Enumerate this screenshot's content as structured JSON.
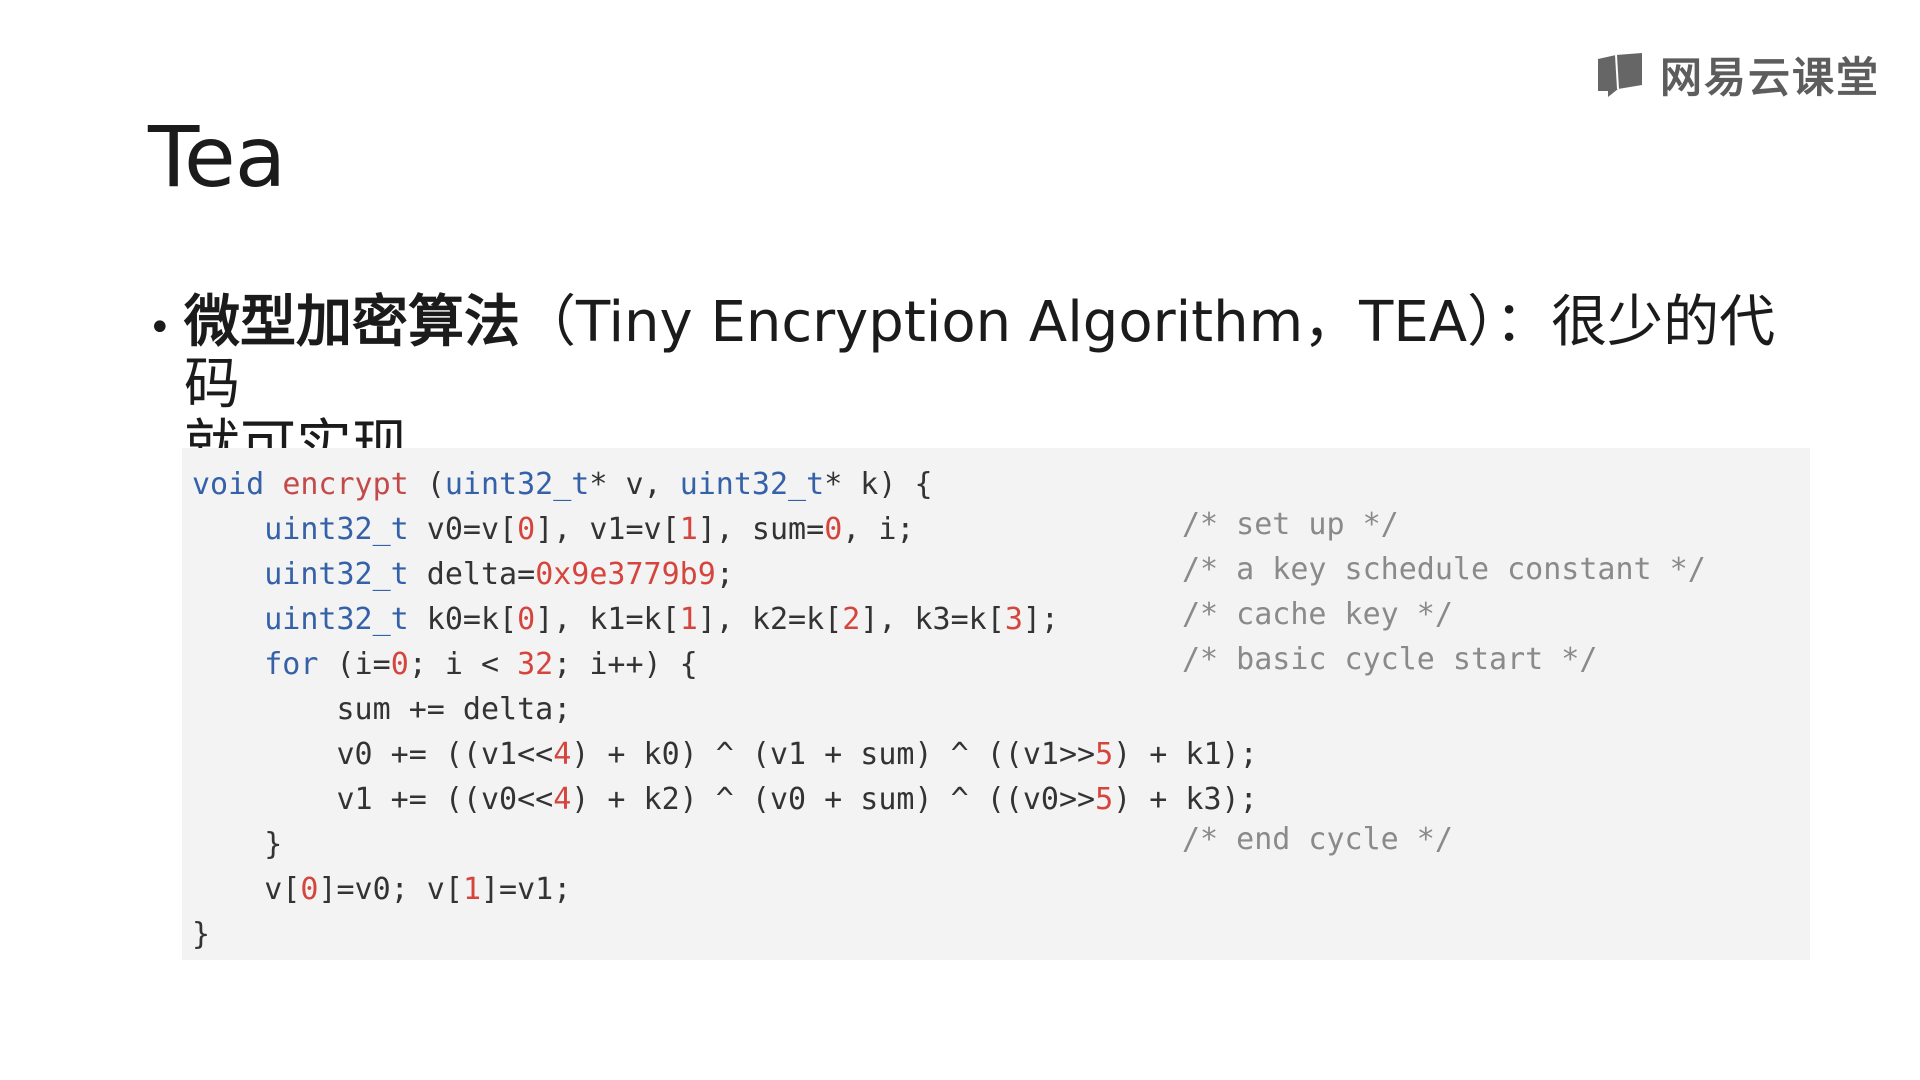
{
  "logo": {
    "text": "网易云课堂",
    "icon": "book-icon"
  },
  "slide": {
    "title": "Tea",
    "bullet": {
      "bold": "微型加密算法",
      "rest": "（Tiny Encryption Algorithm，TEA）：很少的代码",
      "cont": "就可实现"
    }
  },
  "code": {
    "line1": {
      "kw1": "void",
      "sp1": " ",
      "fn": "encrypt",
      "p1": " (",
      "kw2": "uint32_t",
      "p2": "* v, ",
      "kw3": "uint32_t",
      "p3": "* k) {"
    },
    "line2": {
      "indent": "    ",
      "kw": "uint32_t",
      "a": " v0=v[",
      "n1": "0",
      "b": "], v1=v[",
      "n2": "1",
      "c": "], sum=",
      "n3": "0",
      "d": ", i;",
      "comment": "/* set up */"
    },
    "line3": {
      "indent": "    ",
      "kw": "uint32_t",
      "a": " delta=",
      "n1": "0x9e3779b9",
      "b": ";",
      "comment": "/* a key schedule constant */"
    },
    "line4": {
      "indent": "    ",
      "kw": "uint32_t",
      "a": " k0=k[",
      "n1": "0",
      "b": "], k1=k[",
      "n2": "1",
      "c": "], k2=k[",
      "n3": "2",
      "d": "], k3=k[",
      "n4": "3",
      "e": "];",
      "comment": "/* cache key */"
    },
    "line5": {
      "indent": "    ",
      "kw": "for",
      "a": " (i=",
      "n1": "0",
      "b": "; i < ",
      "n2": "32",
      "c": "; i++) {",
      "comment": "/* basic cycle start */"
    },
    "line6": {
      "text": "        sum += delta;"
    },
    "line7": {
      "a": "        v0 += ((v1<<",
      "n1": "4",
      "b": ") + k0) ^ (v1 + sum) ^ ((v1>>",
      "n2": "5",
      "c": ") + k1);"
    },
    "line8": {
      "a": "        v1 += ((v0<<",
      "n1": "4",
      "b": ") + k2) ^ (v0 + sum) ^ ((v0>>",
      "n2": "5",
      "c": ") + k3);"
    },
    "line9": {
      "text": "    }",
      "comment": "/* end cycle */"
    },
    "line10": {
      "a": "    v[",
      "n1": "0",
      "b": "]=v0; v[",
      "n2": "1",
      "c": "]=v1;"
    },
    "line11": {
      "text": "}"
    }
  },
  "colors": {
    "keyword": "#3561a8",
    "function": "#c44a4a",
    "number": "#d6453d",
    "comment": "#8a8a8a",
    "code_bg": "#f3f3f3"
  }
}
